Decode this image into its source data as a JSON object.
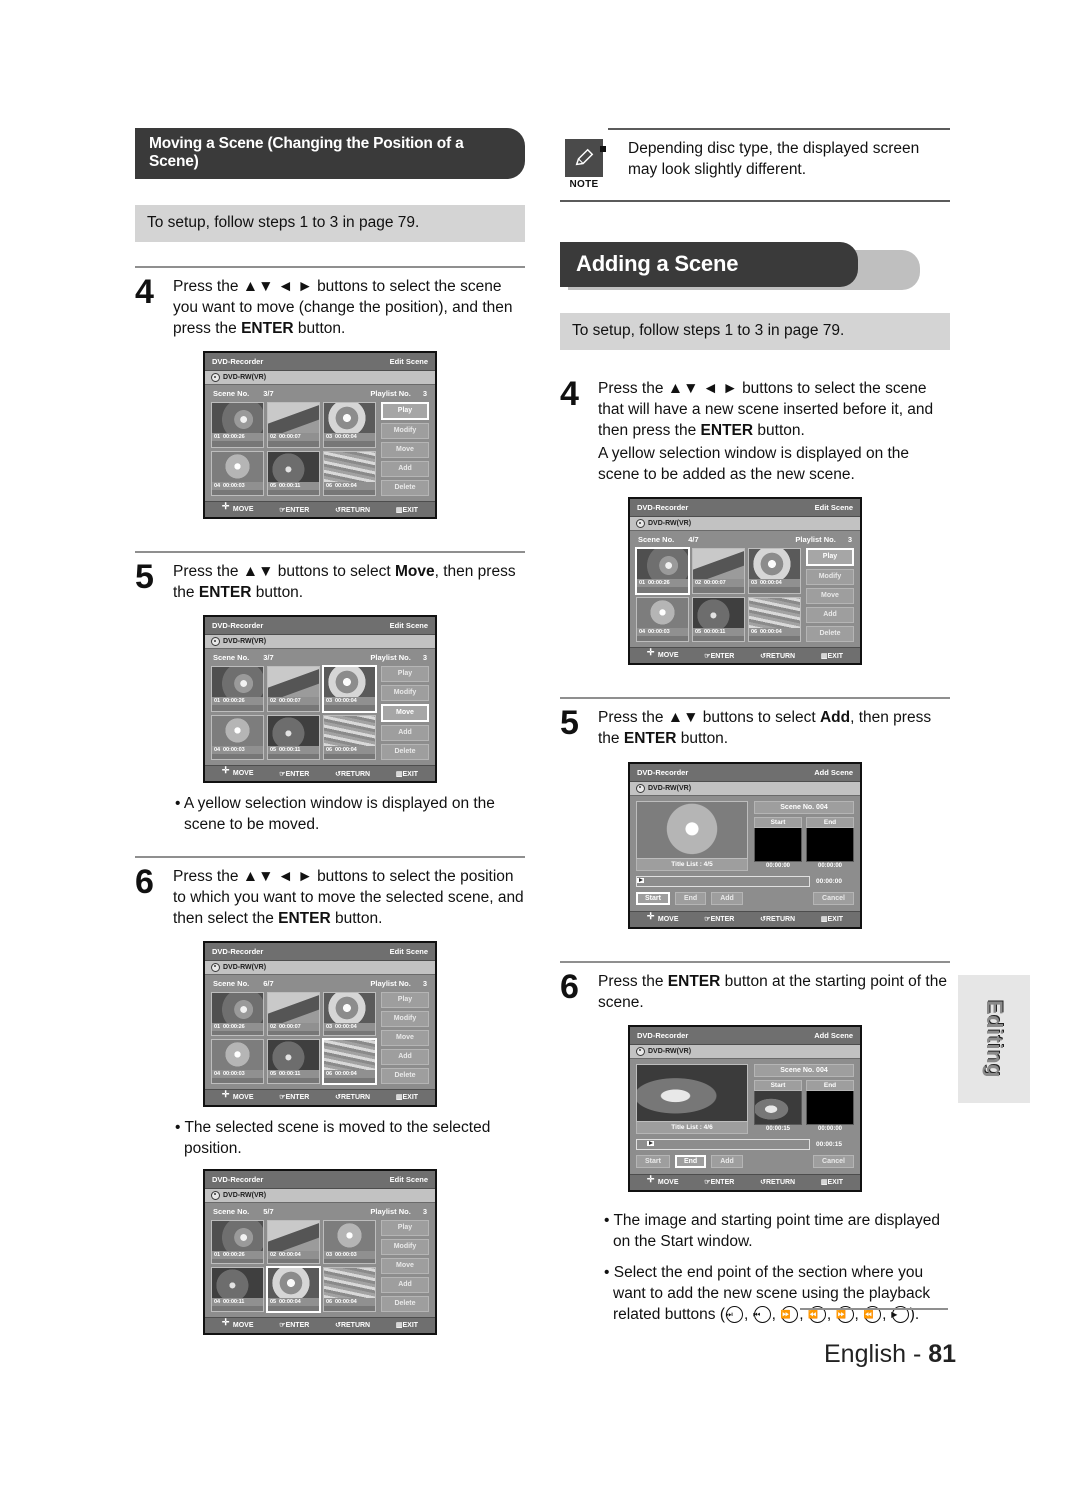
{
  "side_tab": {
    "label": "Editing"
  },
  "footer": {
    "language": "English - ",
    "page": "81"
  },
  "left_column": {
    "banner": "Moving a Scene (Changing the Position of a Scene)",
    "setup_bar": "To setup, follow steps 1 to 3 in page 79.",
    "steps": [
      {
        "number": "4",
        "text_parts": [
          "Press the ▲▼ ◄ ► buttons to select the scene you want to move (change the position), and then press the ",
          "ENTER",
          " button."
        ]
      },
      {
        "number": "5",
        "text_parts": [
          "Press the ▲▼ buttons to select ",
          "Move",
          ", then press the ",
          "ENTER",
          " button."
        ]
      },
      {
        "number": "6",
        "text_parts": [
          "Press the ▲▼ ◄ ► buttons to select the position to which you want to move the selected scene, and then select the ",
          "ENTER",
          " button."
        ]
      }
    ],
    "bullet_after_step5": "A yellow selection window is displayed on the scene to be moved.",
    "bullet_after_step6": "The selected scene is moved to the selected position."
  },
  "right_column": {
    "note": {
      "icon": "pencil-note-icon",
      "icon_label": "NOTE",
      "text": "Depending disc type, the displayed screen may look slightly different."
    },
    "banner": "Adding a Scene",
    "setup_bar": "To setup, follow steps 1 to 3 in page 79.",
    "steps": [
      {
        "number": "4",
        "text_parts": [
          "Press the ▲▼ ◄ ► buttons to select the scene that will have a new scene inserted before it, and then press the ",
          "ENTER",
          " button."
        ],
        "sub_note": "A yellow selection window is displayed on the scene to be added as the new scene."
      },
      {
        "number": "5",
        "text_parts": [
          "Press the ▲▼ buttons to select ",
          "Add",
          ", then press the ",
          "ENTER",
          " button."
        ]
      },
      {
        "number": "6",
        "text_parts": [
          "Press the ",
          "ENTER",
          " button at the starting point of the scene."
        ]
      }
    ],
    "bullets": [
      "The image and starting point time are displayed on the Start window.",
      "Select the end point of the section where you want to add the new scene using the playback related buttons ("
    ],
    "bullets_tail": ").",
    "playback_buttons": [
      "skip-forward-icon",
      "skip-back-icon",
      "fast-forward-icon",
      "rewind-icon",
      "step-forward-icon",
      "slow-back-icon",
      "play-icon"
    ]
  },
  "osd_common": {
    "device": "DVD-Recorder",
    "disc": "DVD-RW(VR)",
    "scene_label": "Scene No.",
    "playlist_label": "Playlist No.",
    "footer": {
      "move": "MOVE",
      "enter": "ENTER",
      "return": "RETURN",
      "exit": "EXIT"
    },
    "menu": [
      "Play",
      "Modify",
      "Move",
      "Add",
      "Delete"
    ]
  },
  "figures": {
    "edit_scene_step4": {
      "screen_title": "Edit Scene",
      "scene_no": "3/7",
      "playlist_no": "3",
      "selected_menu": "Play",
      "selected_thumb": null,
      "thumbs": [
        {
          "no": "01",
          "time": "00:00:26",
          "img": "img-lotus"
        },
        {
          "no": "02",
          "time": "00:00:07",
          "img": "img-dolphin"
        },
        {
          "no": "03",
          "time": "00:00:04",
          "img": "img-flower"
        },
        {
          "no": "04",
          "time": "00:00:03",
          "img": "img-bloom"
        },
        {
          "no": "05",
          "time": "00:00:11",
          "img": "img-buds"
        },
        {
          "no": "06",
          "time": "00:00:04",
          "img": "img-field"
        }
      ]
    },
    "edit_scene_step5": {
      "screen_title": "Edit Scene",
      "scene_no": "3/7",
      "playlist_no": "3",
      "selected_menu": "Move",
      "selected_thumb": "03",
      "thumbs": [
        {
          "no": "01",
          "time": "00:00:26",
          "img": "img-lotus"
        },
        {
          "no": "02",
          "time": "00:00:07",
          "img": "img-dolphin"
        },
        {
          "no": "03",
          "time": "00:00:04",
          "img": "img-flower"
        },
        {
          "no": "04",
          "time": "00:00:03",
          "img": "img-bloom"
        },
        {
          "no": "05",
          "time": "00:00:11",
          "img": "img-buds"
        },
        {
          "no": "06",
          "time": "00:00:04",
          "img": "img-field"
        }
      ]
    },
    "edit_scene_step6": {
      "screen_title": "Edit Scene",
      "scene_no": "6/7",
      "playlist_no": "3",
      "selected_menu": null,
      "selected_thumb": "06",
      "thumbs": [
        {
          "no": "01",
          "time": "00:00:26",
          "img": "img-lotus"
        },
        {
          "no": "02",
          "time": "00:00:07",
          "img": "img-dolphin"
        },
        {
          "no": "03",
          "time": "00:00:04",
          "img": "img-flower"
        },
        {
          "no": "04",
          "time": "00:00:03",
          "img": "img-bloom"
        },
        {
          "no": "05",
          "time": "00:00:11",
          "img": "img-buds"
        },
        {
          "no": "06",
          "time": "00:00:04",
          "img": "img-field"
        }
      ]
    },
    "edit_scene_result": {
      "screen_title": "Edit Scene",
      "scene_no": "5/7",
      "playlist_no": "3",
      "selected_menu": null,
      "selected_thumb": "05",
      "thumbs": [
        {
          "no": "01",
          "time": "00:00:26",
          "img": "img-lotus"
        },
        {
          "no": "02",
          "time": "00:00:04",
          "img": "img-dolphin"
        },
        {
          "no": "03",
          "time": "00:00:03",
          "img": "img-bloom"
        },
        {
          "no": "04",
          "time": "00:00:11",
          "img": "img-buds"
        },
        {
          "no": "05",
          "time": "00:00:04",
          "img": "img-flower"
        },
        {
          "no": "06",
          "time": "00:00:04",
          "img": "img-field"
        }
      ]
    },
    "edit_scene_add_step4": {
      "screen_title": "Edit Scene",
      "scene_no": "4/7",
      "playlist_no": "3",
      "selected_menu": "Play",
      "selected_thumb": "01",
      "thumbs": [
        {
          "no": "01",
          "time": "00:00:26",
          "img": "img-lotus"
        },
        {
          "no": "02",
          "time": "00:00:07",
          "img": "img-dolphin"
        },
        {
          "no": "03",
          "time": "00:00:04",
          "img": "img-flower"
        },
        {
          "no": "04",
          "time": "00:00:03",
          "img": "img-bloom"
        },
        {
          "no": "05",
          "time": "00:00:11",
          "img": "img-buds"
        },
        {
          "no": "06",
          "time": "00:00:04",
          "img": "img-field"
        }
      ]
    },
    "add_scene_step5": {
      "screen_title": "Add Scene",
      "preview_img": "img-bloom",
      "title_list": "Title List : 4/5",
      "scene_no": "Scene No. 004",
      "start_label": "Start",
      "end_label": "End",
      "start_time": "00:00:00",
      "end_time": "00:00:00",
      "start_img": null,
      "end_img": null,
      "progress_time": "00:00:00",
      "progress_pct": 0,
      "buttons": [
        "Start",
        "End",
        "Add"
      ],
      "selected_button": "Start",
      "cancel": "Cancel"
    },
    "add_scene_step6": {
      "screen_title": "Add Scene",
      "preview_img": "img-otter",
      "title_list": "Title List : 4/6",
      "scene_no": "Scene No. 004",
      "start_label": "Start",
      "end_label": "End",
      "start_time": "00:00:15",
      "end_time": "00:00:00",
      "start_img": "img-otter",
      "end_img": null,
      "progress_time": "00:00:15",
      "progress_pct": 6,
      "buttons": [
        "Start",
        "End",
        "Add"
      ],
      "selected_button": "End",
      "cancel": "Cancel"
    }
  }
}
